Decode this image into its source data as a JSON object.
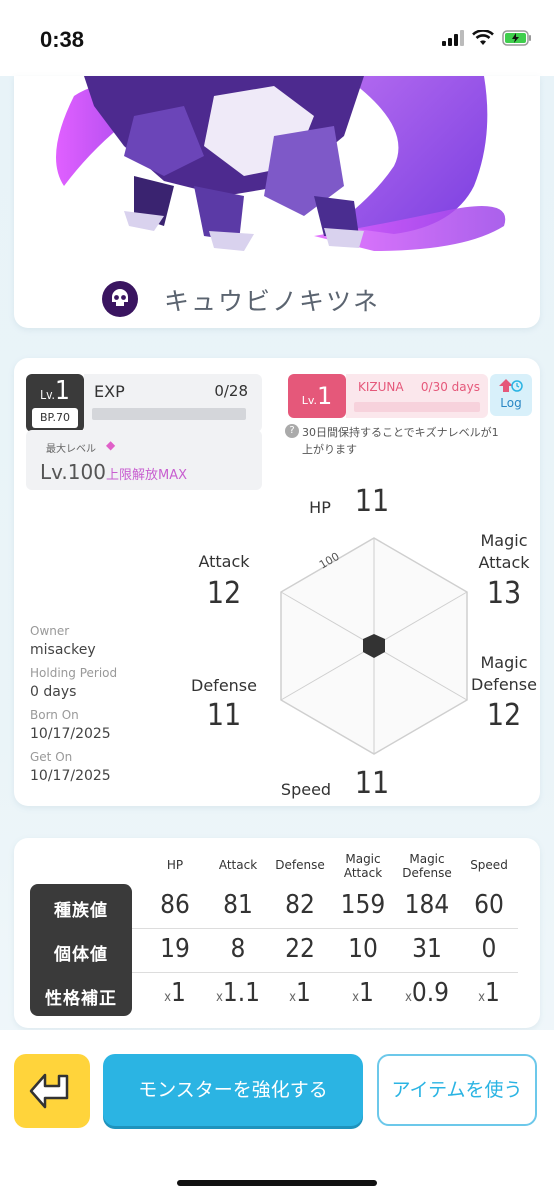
{
  "status": {
    "time": "0:38"
  },
  "monster": {
    "name": "キュウビノキツネ",
    "type_icon": "skull-icon"
  },
  "level": {
    "label": "Lv.",
    "value": "1",
    "bp": "BP.70"
  },
  "exp": {
    "label": "EXP",
    "value": "0/28",
    "progress": 0
  },
  "max_level": {
    "label": "最大レベル",
    "value": "Lv.100",
    "unlock": "上限解放MAX"
  },
  "kizuna": {
    "lv_label": "Lv.",
    "lv_value": "1",
    "label": "KIZUNA",
    "value": "0/30 days",
    "log": "Log",
    "note": "30日間保持することでキズナレベルが1上がります",
    "progress": 0
  },
  "profile": {
    "owner_label": "Owner",
    "owner": "misackey",
    "holding_label": "Holding Period",
    "holding": "0 days",
    "born_label": "Born On",
    "born": "10/17/2025",
    "get_label": "Get On",
    "get": "10/17/2025"
  },
  "radar": {
    "scale_label": "100",
    "stats": [
      {
        "key": "hp",
        "label": "HP",
        "value": "11"
      },
      {
        "key": "magic_attack",
        "label": "Magic Attack",
        "value": "13"
      },
      {
        "key": "magic_defense",
        "label": "Magic Defense",
        "value": "12"
      },
      {
        "key": "speed",
        "label": "Speed",
        "value": "11"
      },
      {
        "key": "defense",
        "label": "Defense",
        "value": "11"
      },
      {
        "key": "attack",
        "label": "Attack",
        "value": "12"
      }
    ]
  },
  "table": {
    "headers": [
      "HP",
      "Attack",
      "Defense",
      "Magic Attack",
      "Magic Defense",
      "Speed"
    ],
    "rows": [
      {
        "label": "種族値",
        "values": [
          "86",
          "81",
          "82",
          "159",
          "184",
          "60"
        ]
      },
      {
        "label": "個体値",
        "values": [
          "19",
          "8",
          "22",
          "10",
          "31",
          "0"
        ]
      },
      {
        "label": "性格補正",
        "prefix": "x",
        "values": [
          "1",
          "1.1",
          "1",
          "1",
          "0.9",
          "1"
        ]
      }
    ]
  },
  "buttons": {
    "enhance": "モンスターを強化する",
    "use_item": "アイテムを使う"
  },
  "colors": {
    "accent_blue": "#2bb4e3",
    "kizuna_pink": "#e5587a",
    "back_yellow": "#ffd43b"
  }
}
